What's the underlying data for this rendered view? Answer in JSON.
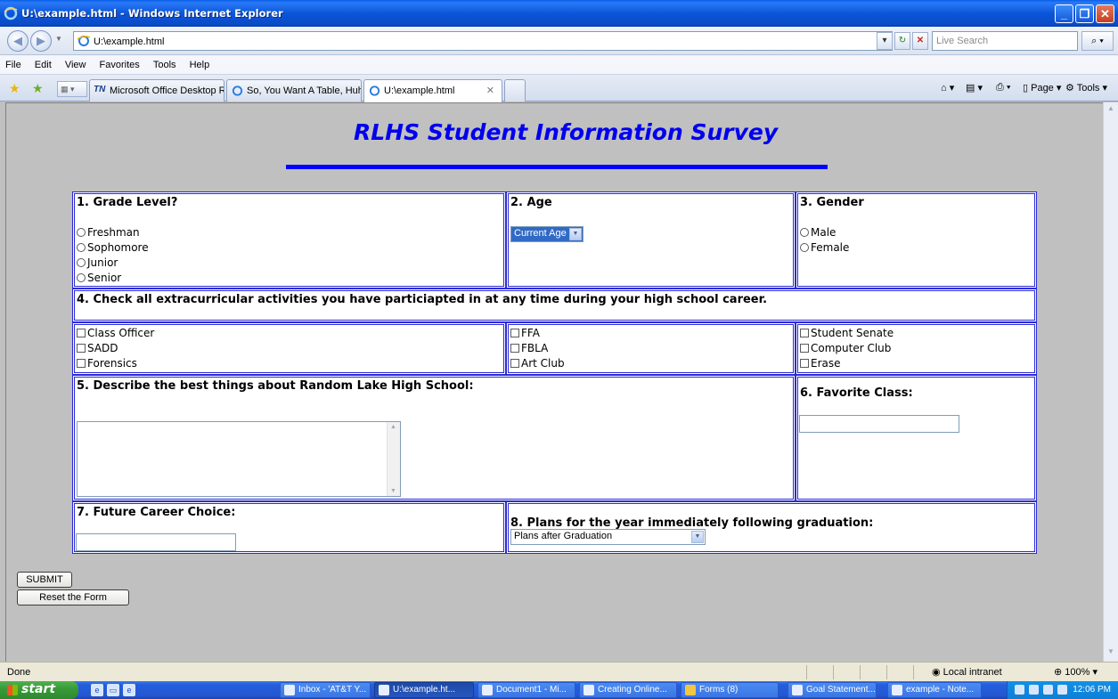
{
  "window": {
    "title": "U:\\example.html - Windows Internet Explorer",
    "minimize": "_",
    "maximize": "❐",
    "close": "✕"
  },
  "address_bar": {
    "url": "U:\\example.html",
    "search_placeholder": "Live Search"
  },
  "menu": [
    "File",
    "Edit",
    "View",
    "Favorites",
    "Tools",
    "Help"
  ],
  "tabs": [
    {
      "label": "Microsoft Office Desktop Res..."
    },
    {
      "label": "So, You Want A Table, Huh?"
    },
    {
      "label": "U:\\example.html"
    }
  ],
  "toolbar_right": {
    "page": "Page",
    "tools": "Tools"
  },
  "survey": {
    "title": "RLHS Student Information Survey",
    "q1": {
      "label": "1. Grade Level?",
      "options": [
        "Freshman",
        "Sophomore",
        "Junior",
        "Senior"
      ]
    },
    "q2": {
      "label": "2. Age",
      "select_value": "Current Age"
    },
    "q3": {
      "label": "3. Gender",
      "options": [
        "Male",
        "Female"
      ]
    },
    "q4": {
      "label": "4. Check all extracurricular activities you have particiapted in at any time during your high school career.",
      "col1": [
        "Class Officer",
        "SADD",
        "Forensics"
      ],
      "col2": [
        "FFA",
        "FBLA",
        "Art Club"
      ],
      "col3": [
        "Student Senate",
        "Computer Club",
        "Erase"
      ]
    },
    "q5": {
      "label": "5. Describe the best things about Random Lake High School:"
    },
    "q6": {
      "label": "6. Favorite Class:"
    },
    "q7": {
      "label": "7. Future Career Choice:"
    },
    "q8": {
      "label": "8. Plans for the year immediately following graduation:",
      "select_value": "Plans after Graduation"
    },
    "submit_label": "SUBMIT",
    "reset_label": "Reset the Form"
  },
  "status_bar": {
    "status": "Done",
    "zone": "Local intranet",
    "zoom": "100%"
  },
  "taskbar": {
    "start": "start",
    "items": [
      {
        "label": "Inbox - 'AT&T Y..."
      },
      {
        "label": "U:\\example.ht..."
      },
      {
        "label": "Document1 - Mi..."
      },
      {
        "label": "Creating Online..."
      },
      {
        "label": "Forms (8)"
      },
      {
        "label": "Goal Statement..."
      },
      {
        "label": "example - Note..."
      }
    ],
    "clock": "12:06 PM"
  },
  "colors": {
    "title_blue": "#0000ee",
    "rule_blue": "#0000ff",
    "cell_border": "#2b2bd6",
    "page_bg": "#c0c0c0"
  }
}
